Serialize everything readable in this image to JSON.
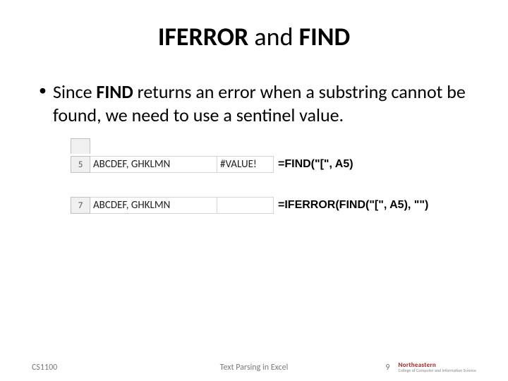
{
  "title": {
    "bold1": "IFERROR",
    "mid": " and ",
    "bold2": "FIND"
  },
  "bullet": {
    "pre": "Since ",
    "bold": "FIND",
    "post": " returns an error when a substring cannot be found, we need to use a sentinel value."
  },
  "excel1": {
    "row": "5",
    "a": "ABCDEF, GHKLMN",
    "b": "#VALUE!",
    "formula": "=FIND(\"[\", A5)"
  },
  "excel2": {
    "row": "7",
    "a": "ABCDEF, GHKLMN",
    "b": "",
    "formula": "=IFERROR(FIND(\"[\", A5), \"\")"
  },
  "footer": {
    "left": "CS1100",
    "center": "Text Parsing in Excel",
    "page": "9",
    "logo_top": "Northeastern",
    "logo_bottom": "College of Computer and Information Science"
  }
}
